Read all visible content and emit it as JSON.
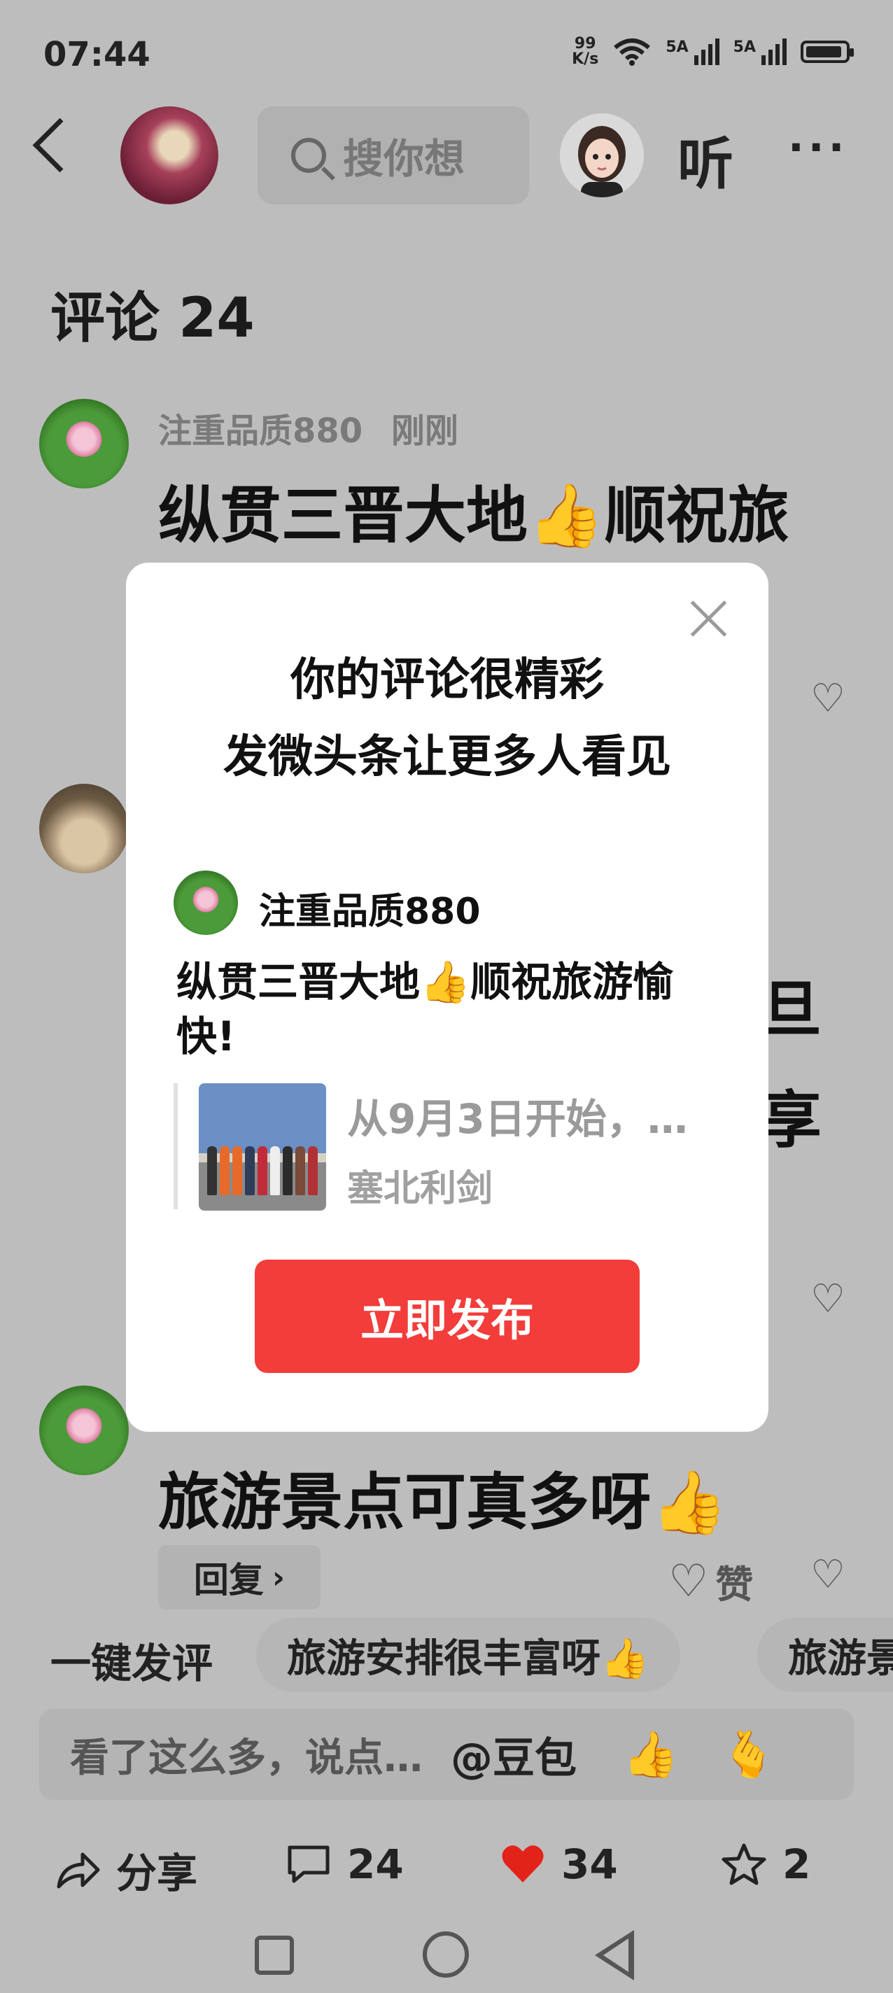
{
  "status_bar": {
    "time": "07:44",
    "net_speed_top": "99",
    "net_speed_bottom": "K/s",
    "sig1": "5A",
    "sig2": "5A"
  },
  "header": {
    "search_placeholder": "搜你想",
    "listen_label": "听",
    "more_label": "···"
  },
  "comments": {
    "title": "评论 24",
    "items": [
      {
        "user": "注重品质880",
        "time": "刚刚",
        "text": "纵贯三晋大地👍顺祝旅"
      },
      {
        "text": "旅游景点可真多呀👍"
      }
    ],
    "partial_right_1": "旦",
    "partial_right_2": "享",
    "reply_label": "回复",
    "like_label": "赞"
  },
  "quick_reply": {
    "label": "一键发评",
    "chips": [
      "旅游安排很丰富呀👍",
      "旅游景"
    ]
  },
  "input": {
    "placeholder": "看了这么多，说点…",
    "at_label": "@豆包",
    "emoji1": "👍",
    "emoji2": "🫰"
  },
  "actions": {
    "share_label": "分享",
    "comment_count": "24",
    "like_count": "34",
    "fav_count": "2"
  },
  "modal": {
    "title_line1": "你的评论很精彩",
    "title_line2": "发微头条让更多人看见",
    "author": "注重品质880",
    "comment_text": "纵贯三晋大地👍顺祝旅游愉快!",
    "quote_title": "从9月3日开始，…",
    "quote_source": "塞北利剑",
    "publish_label": "立即发布"
  },
  "colors": {
    "accent_red": "#f23d3a",
    "heart_red": "#e2231a"
  }
}
